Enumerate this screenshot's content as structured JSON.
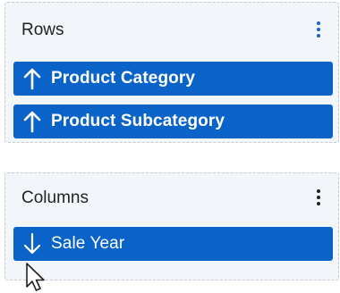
{
  "rows_panel": {
    "title": "Rows",
    "menu_icon": "kebab-vertical-icon",
    "items": [
      {
        "label": "Product Category",
        "sort_icon": "arrow-up-icon"
      },
      {
        "label": "Product Subcategory",
        "sort_icon": "arrow-up-icon"
      }
    ]
  },
  "columns_panel": {
    "title": "Columns",
    "menu_icon": "kebab-vertical-icon",
    "items": [
      {
        "label": "Sale Year",
        "sort_icon": "arrow-down-icon"
      }
    ]
  },
  "cursor_icon": "mouse-pointer-icon",
  "colors": {
    "chip_background": "#0a63c9",
    "panel_background": "#f2f6fa",
    "panel_border": "#c4cad0",
    "accent_menu": "#1f62c9"
  }
}
